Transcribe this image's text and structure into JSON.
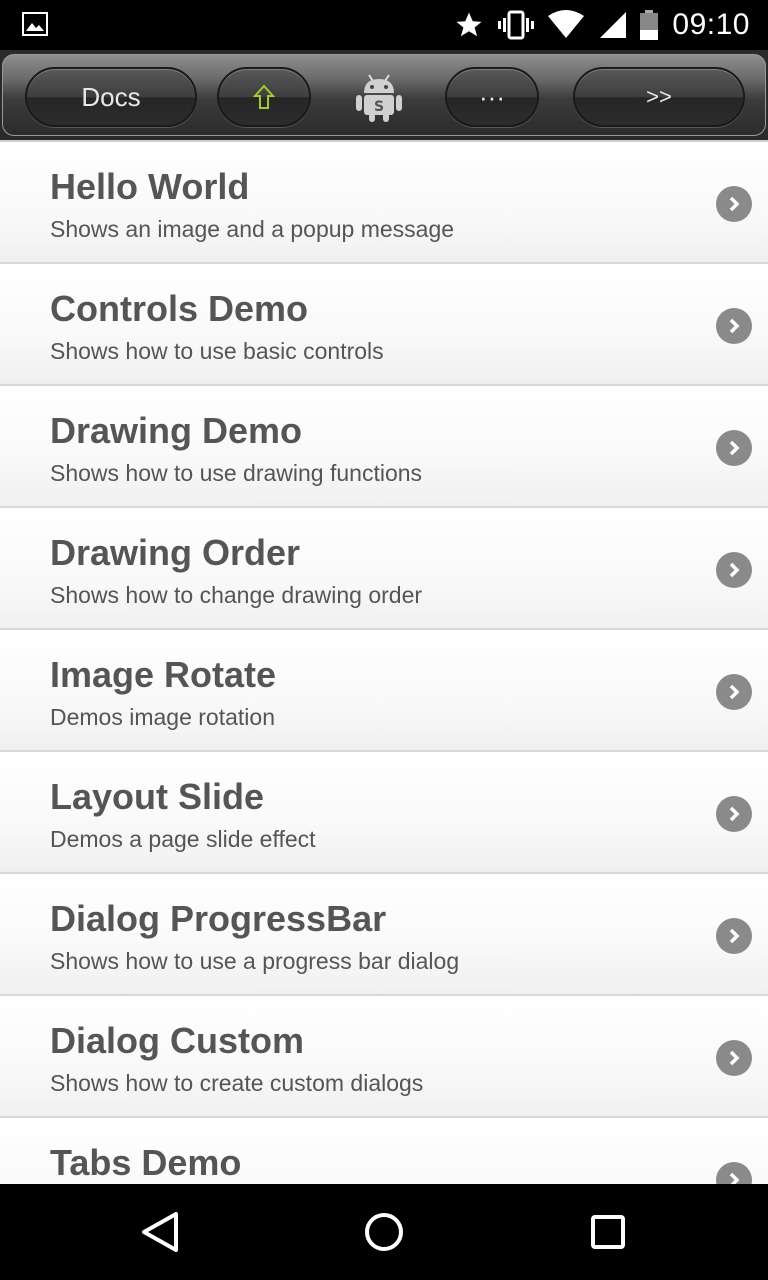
{
  "status_bar": {
    "time": "09:10",
    "icons": [
      "image-notification-icon",
      "star-icon",
      "vibrate-icon",
      "wifi-icon",
      "cell-signal-icon",
      "battery-icon"
    ]
  },
  "toolbar": {
    "docs_label": "Docs",
    "up_label": "⇧",
    "menu_label": "···",
    "next_label": ">>",
    "logo_icon": "android-robot-icon",
    "accent": "#a6c832"
  },
  "list": {
    "items": [
      {
        "title": "Hello World",
        "subtitle": "Shows an image and a popup message"
      },
      {
        "title": "Controls Demo",
        "subtitle": "Shows how to use basic controls"
      },
      {
        "title": "Drawing Demo",
        "subtitle": "Shows how to use drawing functions"
      },
      {
        "title": "Drawing Order",
        "subtitle": "Shows how to change drawing order"
      },
      {
        "title": "Image Rotate",
        "subtitle": "Demos image rotation"
      },
      {
        "title": "Layout Slide",
        "subtitle": "Demos a page slide effect"
      },
      {
        "title": "Dialog ProgressBar",
        "subtitle": "Shows how to use a progress bar dialog"
      },
      {
        "title": "Dialog Custom",
        "subtitle": "Shows how to create custom dialogs"
      },
      {
        "title": "Tabs Demo",
        "subtitle": ""
      }
    ]
  },
  "nav_bar": {
    "icons": [
      "back-icon",
      "home-icon",
      "recents-icon"
    ]
  }
}
